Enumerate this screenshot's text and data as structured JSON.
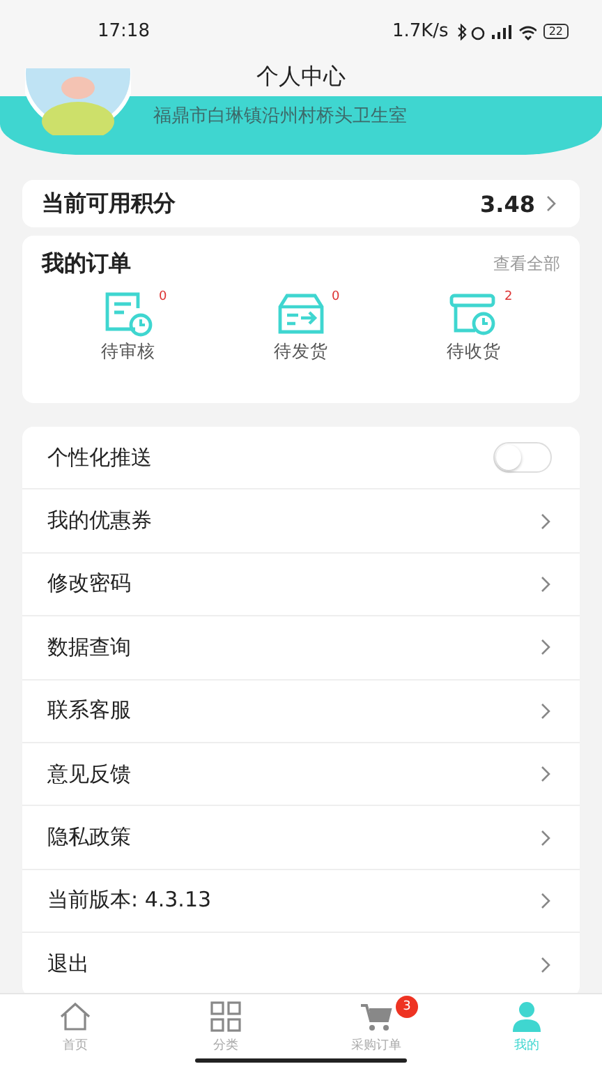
{
  "status_bar": {
    "time": "17:18",
    "speed": "1.7K/s",
    "battery": "22"
  },
  "header": {
    "title": "个人中心"
  },
  "profile": {
    "address": "福鼎市白琳镇沿州村桥头卫生室"
  },
  "points": {
    "label": "当前可用积分",
    "value": "3.48"
  },
  "orders": {
    "title": "我的订单",
    "view_all": "查看全部",
    "items": [
      {
        "kind": "review",
        "label": "待审核",
        "count": "0"
      },
      {
        "kind": "ship",
        "label": "待发货",
        "count": "0"
      },
      {
        "kind": "receive",
        "label": "待收货",
        "count": "2"
      }
    ]
  },
  "menu": [
    {
      "kind": "toggle",
      "label": "个性化推送",
      "on": false
    },
    {
      "kind": "link",
      "label": "我的优惠券"
    },
    {
      "kind": "link",
      "label": "修改密码"
    },
    {
      "kind": "link",
      "label": "数据查询"
    },
    {
      "kind": "link",
      "label": "联系客服"
    },
    {
      "kind": "link",
      "label": "意见反馈"
    },
    {
      "kind": "link",
      "label": "隐私政策"
    },
    {
      "kind": "link",
      "label": "当前版本: 4.3.13"
    },
    {
      "kind": "link",
      "label": "退出"
    }
  ],
  "tab_bar": [
    {
      "kind": "home",
      "label": "首页",
      "selected": false
    },
    {
      "kind": "grid",
      "label": "分类",
      "selected": false
    },
    {
      "kind": "cart",
      "label": "采购订单",
      "selected": false,
      "badge": "3"
    },
    {
      "kind": "person",
      "label": "我的",
      "selected": true
    }
  ]
}
